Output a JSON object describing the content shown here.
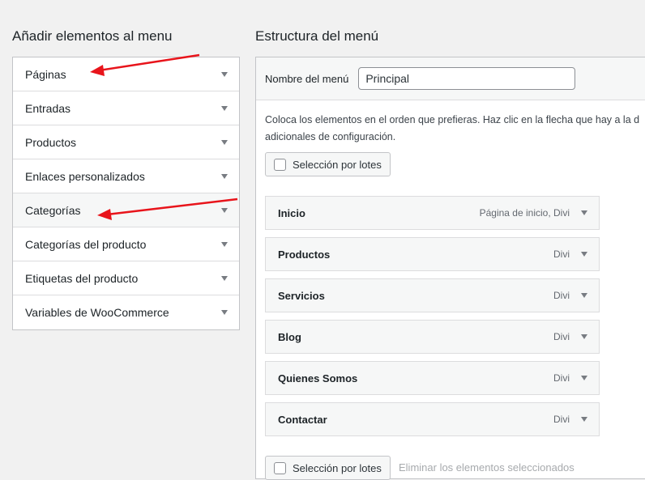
{
  "left": {
    "title": "Añadir elementos al menu",
    "items": [
      {
        "label": "Páginas"
      },
      {
        "label": "Entradas"
      },
      {
        "label": "Productos"
      },
      {
        "label": "Enlaces personalizados"
      },
      {
        "label": "Categorías"
      },
      {
        "label": "Categorías del producto"
      },
      {
        "label": "Etiquetas del producto"
      },
      {
        "label": "Variables de WooCommerce"
      }
    ]
  },
  "right": {
    "title": "Estructura del menú",
    "name_label": "Nombre del menú",
    "name_value": "Principal",
    "instructions_line1": "Coloca los elementos en el orden que prefieras. Haz clic en la flecha que hay a la d",
    "instructions_line2": "adicionales de configuración.",
    "bulk_select_label": "Selección por lotes",
    "delete_selected_label": "Eliminar los elementos seleccionados",
    "menu_items": [
      {
        "title": "Inicio",
        "type": "Página de inicio, Divi"
      },
      {
        "title": "Productos",
        "type": "Divi"
      },
      {
        "title": "Servicios",
        "type": "Divi"
      },
      {
        "title": "Blog",
        "type": "Divi"
      },
      {
        "title": "Quienes Somos",
        "type": "Divi"
      },
      {
        "title": "Contactar",
        "type": "Divi"
      }
    ]
  },
  "colors": {
    "annotation_arrow": "#e8141b",
    "background": "#f1f1f1",
    "border": "#c3c4c7"
  },
  "icons": {
    "accordion_toggle": "triangle-down-icon",
    "checkbox": "checkbox-icon",
    "annotation": "red-arrow-icon"
  }
}
